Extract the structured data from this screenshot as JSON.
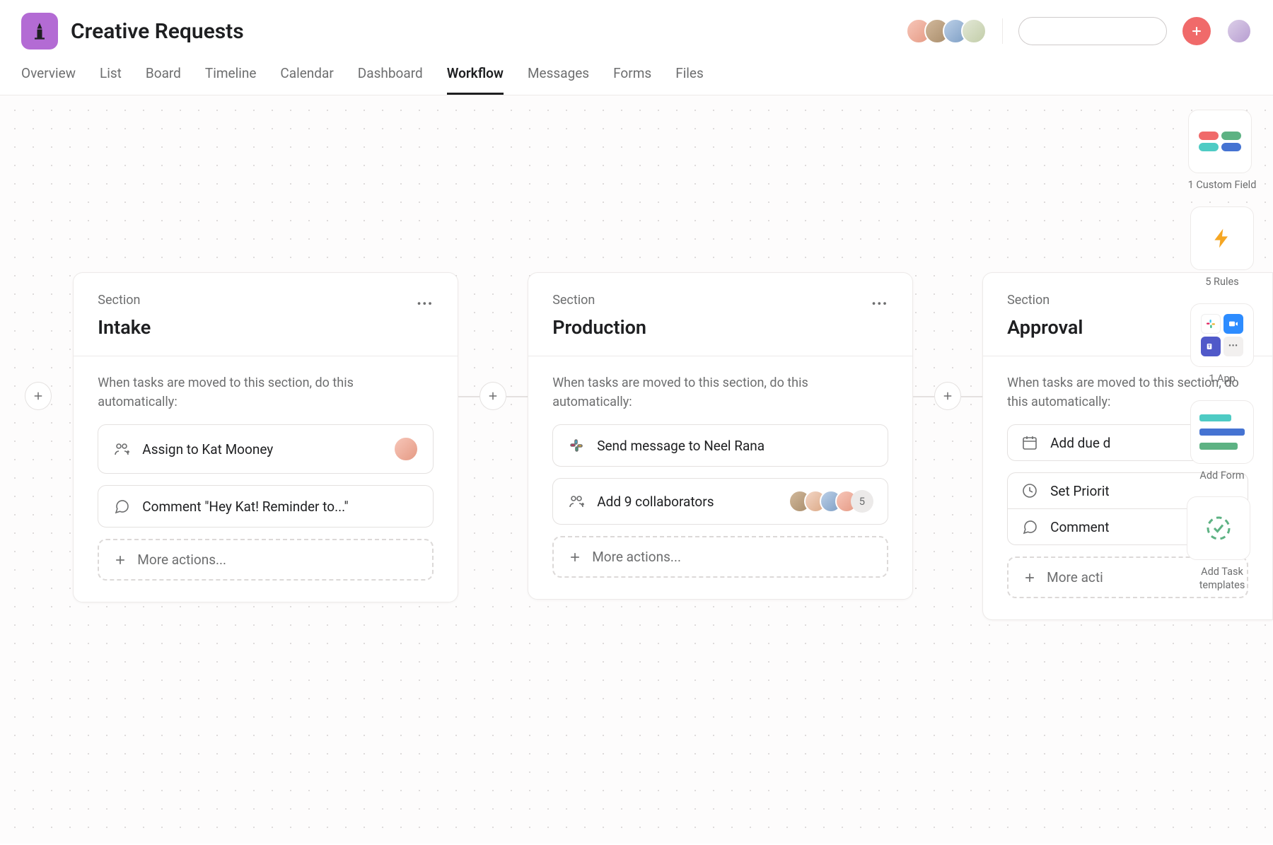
{
  "project": {
    "title": "Creative Requests"
  },
  "tabs": [
    {
      "label": "Overview",
      "active": false
    },
    {
      "label": "List",
      "active": false
    },
    {
      "label": "Board",
      "active": false
    },
    {
      "label": "Timeline",
      "active": false
    },
    {
      "label": "Calendar",
      "active": false
    },
    {
      "label": "Dashboard",
      "active": false
    },
    {
      "label": "Workflow",
      "active": true
    },
    {
      "label": "Messages",
      "active": false
    },
    {
      "label": "Forms",
      "active": false
    },
    {
      "label": "Files",
      "active": false
    }
  ],
  "search": {
    "placeholder": ""
  },
  "section_label": "Section",
  "hint_text": "When tasks are moved to this section, do this automatically:",
  "more_actions_label": "More actions...",
  "sections": {
    "intake": {
      "title": "Intake",
      "rules": [
        {
          "icon": "assign",
          "text": "Assign to Kat Mooney",
          "avatar": true
        },
        {
          "icon": "comment",
          "text": "Comment \"Hey Kat! Reminder to...\""
        }
      ]
    },
    "production": {
      "title": "Production",
      "rules": [
        {
          "icon": "slack",
          "text": "Send message to Neel Rana"
        },
        {
          "icon": "collaborators",
          "text": "Add 9 collaborators",
          "avatars": 4,
          "extra": "5"
        }
      ]
    },
    "approval": {
      "title": "Approval",
      "hint": "When tasks are moved to this section, do this automatically:",
      "rules": [
        {
          "icon": "calendar",
          "text": "Add due d"
        },
        {
          "icon": "priority",
          "text": "Set Priorit"
        },
        {
          "icon": "comment",
          "text": "Comment"
        }
      ],
      "more": "More acti"
    }
  },
  "right_panel": {
    "custom_fields": "1 Custom Field",
    "rules": "5 Rules",
    "app": "1 App",
    "add_form": "Add Form",
    "task_templates": "Add Task templates"
  },
  "colors": {
    "accent_purple": "#b36bd4",
    "accent_red": "#f06a6a",
    "pill_red": "#f06a6a",
    "pill_green": "#5db283",
    "pill_cyan": "#4ecbc4",
    "pill_blue": "#4573d2"
  }
}
